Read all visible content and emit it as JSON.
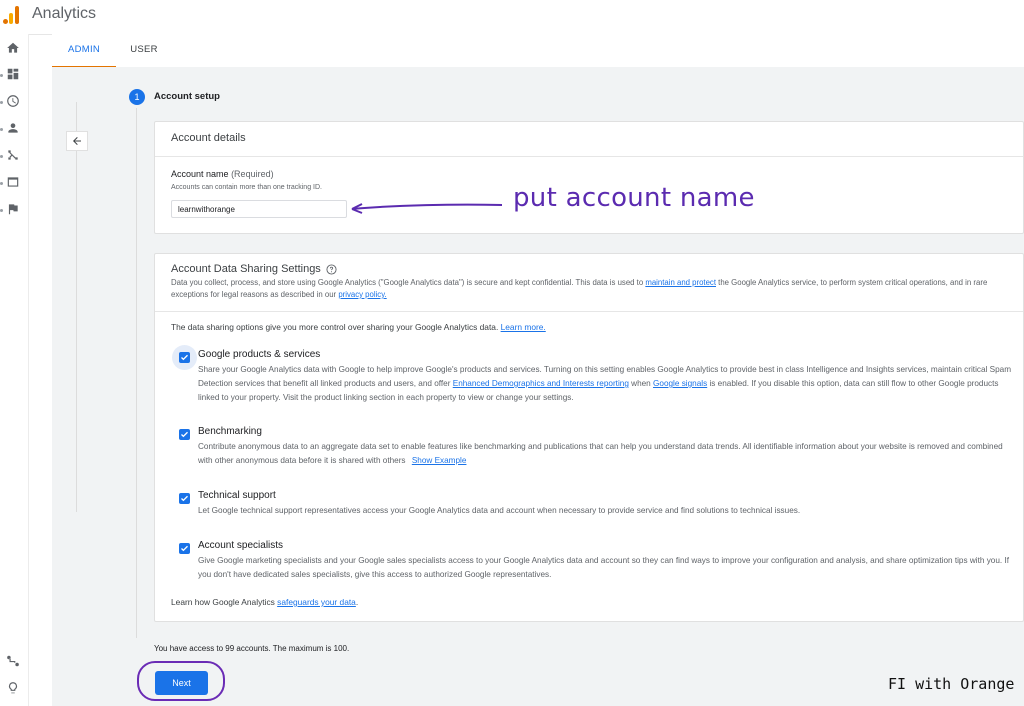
{
  "app": {
    "title": "Analytics"
  },
  "tabs": [
    {
      "label": "ADMIN",
      "active": true
    },
    {
      "label": "USER",
      "active": false
    }
  ],
  "step": {
    "number": "1",
    "label": "Account setup"
  },
  "account_details": {
    "heading": "Account details",
    "field_label": "Account name",
    "required_label": "(Required)",
    "hint": "Accounts can contain more than one tracking ID.",
    "value": "learnwithorange"
  },
  "data_sharing": {
    "heading": "Account Data Sharing Settings",
    "intro_1": "Data you collect, process, and store using Google Analytics (\"Google Analytics data\") is secure and kept confidential. This data is used to",
    "intro_link_1": "maintain and protect",
    "intro_2": "the Google Analytics service, to perform system critical operations, and in rare exceptions for legal reasons as described in our",
    "intro_link_2": "privacy policy.",
    "options_text": "The data sharing options give you more control over sharing your Google Analytics data.",
    "learn_more": "Learn more.",
    "options": [
      {
        "title": "Google products & services",
        "checked": true,
        "desc_1": "Share your Google Analytics data with Google to help improve Google's products and services. Turning on this setting enables Google Analytics to provide best in class Intelligence and Insights services, maintain critical Spam Detection services that benefit all linked products and users, and offer",
        "link_1": "Enhanced Demographics and Interests reporting",
        "desc_2": "when",
        "link_2": "Google signals",
        "desc_3": "is enabled. If you disable this option, data can still flow to other Google products linked to your property. Visit the product linking section in each property to view or change your settings."
      },
      {
        "title": "Benchmarking",
        "checked": true,
        "desc_1": "Contribute anonymous data to an aggregate data set to enable features like benchmarking and publications that can help you understand data trends. All identifiable information about your website is removed and combined with other anonymous data before it is shared with others",
        "link_1": "Show Example"
      },
      {
        "title": "Technical support",
        "checked": true,
        "desc_1": "Let Google technical support representatives access your Google Analytics data and account when necessary to provide service and find solutions to technical issues."
      },
      {
        "title": "Account specialists",
        "checked": true,
        "desc_1": "Give Google marketing specialists and your Google sales specialists access to your Google Analytics data and account so they can find ways to improve your configuration and analysis, and share optimization tips with you. If you don't have dedicated sales specialists, give this access to authorized Google representatives."
      }
    ],
    "safeguards_text": "Learn how Google Analytics",
    "safeguards_link": "safeguards your data",
    "safeguards_end": "."
  },
  "access_note": "You have access to 99 accounts. The maximum is 100.",
  "next_label": "Next",
  "annotation": "put account name",
  "watermark": "FI with Orange",
  "colors": {
    "primary": "#1a73e8",
    "annotation": "#5b2bb0",
    "tab_indicator": "#e37400"
  },
  "icons": [
    "home-icon",
    "dashboard-icon",
    "clock-icon",
    "person-icon",
    "acquisition-icon",
    "display-icon",
    "flag-icon",
    "attribution-icon",
    "lightbulb-icon",
    "back-arrow-icon",
    "help-icon",
    "check-icon"
  ]
}
